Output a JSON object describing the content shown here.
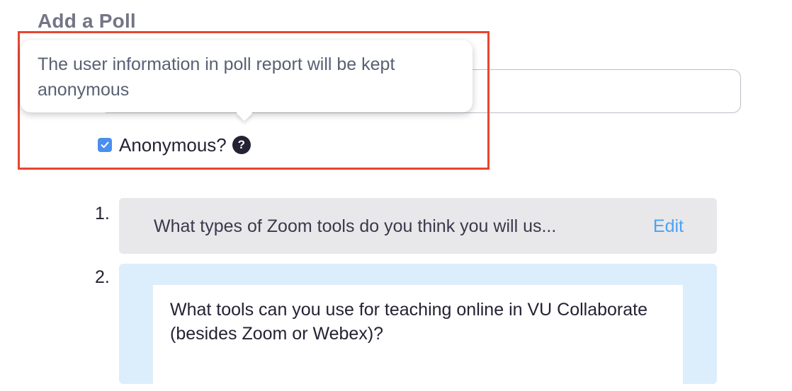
{
  "page": {
    "title": "Add a Poll"
  },
  "tooltip": {
    "text": "The user information in poll report will be kept anonymous"
  },
  "anonymous": {
    "label": "Anonymous?",
    "checked": true,
    "help_glyph": "?"
  },
  "questions": [
    {
      "number": "1.",
      "text": "What types of Zoom tools do you think you will us...",
      "edit_label": "Edit"
    },
    {
      "number": "2.",
      "text": "What tools can you use for teaching online in VU Collaborate (besides Zoom or Webex)?"
    }
  ],
  "colors": {
    "highlight": "#e8452f",
    "checkbox": "#4a8ef0",
    "edit_link": "#4aa3f5",
    "question_selected_bg": "#dcedfc"
  }
}
